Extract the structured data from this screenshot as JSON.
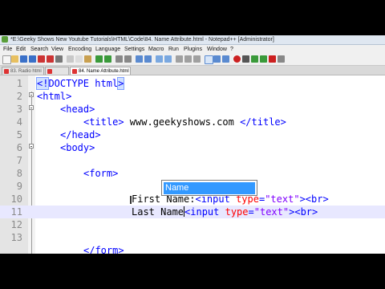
{
  "window": {
    "title": "*E:\\Geeky Shows New Youtube Tutorials\\HTML\\Code\\84. Name Attribute.html - Notepad++ [Administrator]"
  },
  "menubar": {
    "items": [
      "File",
      "Edit",
      "Search",
      "View",
      "Encoding",
      "Language",
      "Settings",
      "Macro",
      "Run",
      "Plugins",
      "Window",
      "?"
    ]
  },
  "tabs": [
    {
      "label": "83. Radio html",
      "active": false
    },
    {
      "label": "",
      "active": false
    },
    {
      "label": "84. Name Attribute.html",
      "active": true
    }
  ],
  "editor": {
    "line_numbers": [
      "1",
      "2",
      "3",
      "4",
      "5",
      "6",
      "7",
      "8",
      "9",
      "10",
      "11",
      "12",
      "13",
      ""
    ],
    "lines": {
      "l1": {
        "open": "<!",
        "kw": "DOCTYPE html",
        "close": ">"
      },
      "l2": {
        "tag": "<html>"
      },
      "l3": {
        "tag": "<head>"
      },
      "l4": {
        "open": "<title>",
        "text": " www.geekyshows.com ",
        "close": "</title>"
      },
      "l5": {
        "tag": "</head>"
      },
      "l6": {
        "tag": "<body>"
      },
      "l8": {
        "tag": "<form>"
      },
      "l10": {
        "text": "First Name:",
        "open": "<input ",
        "attr": "type",
        "eq": "=",
        "val": "\"text\"",
        "gt": ">",
        "br": "<br>"
      },
      "l11": {
        "text": "Last Name",
        "open": "<input ",
        "attr": "type",
        "eq": "=",
        "val": "\"text\"",
        "gt": ">",
        "br": "<br>"
      },
      "l14": {
        "tag": "</form>"
      }
    },
    "current_line": 11
  },
  "autocomplete": {
    "items": [
      "Name"
    ],
    "selected": "Name"
  },
  "colors": {
    "tag": "#0000ff",
    "attribute": "#ff0000",
    "value": "#8000ff",
    "selection": "#3399ff",
    "current_line": "#e8e8ff"
  }
}
